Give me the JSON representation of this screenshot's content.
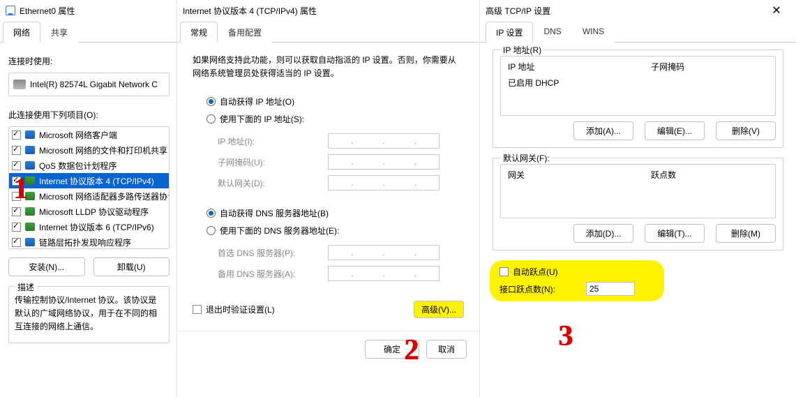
{
  "d1": {
    "title": "Ethernet0 属性",
    "tab_network": "网络",
    "tab_share": "共享",
    "connect_using": "连接时使用:",
    "adapter": "Intel(R) 82574L Gigabit Network C",
    "uses_items": "此连接使用下列项目(O):",
    "items": [
      {
        "checked": true,
        "label": "Microsoft 网络客户端",
        "sel": false
      },
      {
        "checked": true,
        "label": "Microsoft 网络的文件和打印机共享",
        "sel": false
      },
      {
        "checked": true,
        "label": "QoS 数据包计划程序",
        "sel": false
      },
      {
        "checked": true,
        "label": "Internet 协议版本 4 (TCP/IPv4)",
        "sel": true
      },
      {
        "checked": false,
        "label": "Microsoft 网络适配器多路传送器协议",
        "sel": false
      },
      {
        "checked": true,
        "label": "Microsoft LLDP 协议驱动程序",
        "sel": false
      },
      {
        "checked": true,
        "label": "Internet 协议版本 6 (TCP/IPv6)",
        "sel": false
      },
      {
        "checked": true,
        "label": "链路层拓扑发现响应程序",
        "sel": false
      }
    ],
    "install": "安装(N)...",
    "uninstall": "卸载(U)",
    "desc_legend": "描述",
    "desc_text": "传输控制协议/Internet 协议。该协议是默认的广域网络协议，用于在不同的相互连接的网络上通信。"
  },
  "d2": {
    "title": "Internet 协议版本 4 (TCP/IPv4) 属性",
    "tab_general": "常规",
    "tab_alt": "备用配置",
    "intro": "如果网络支持此功能，则可以获取自动指派的 IP 设置。否则，你需要从网络系统管理员处获得适当的 IP 设置。",
    "r_auto_ip": "自动获得 IP 地址(O)",
    "r_manual_ip": "使用下面的 IP 地址(S):",
    "f_ip": "IP 地址(I):",
    "f_mask": "子网掩码(U):",
    "f_gw": "默认网关(D):",
    "r_auto_dns": "自动获得 DNS 服务器地址(B)",
    "r_manual_dns": "使用下面的 DNS 服务器地址(E):",
    "f_dns1": "首选 DNS 服务器(P):",
    "f_dns2": "备用 DNS 服务器(A):",
    "chk_validate": "退出时验证设置(L)",
    "advanced": "高级(V)...",
    "ok": "确定",
    "cancel": "取消"
  },
  "d3": {
    "title": "高级 TCP/IP 设置",
    "tab_ip": "IP 设置",
    "tab_dns": "DNS",
    "tab_wins": "WINS",
    "grp_ip": "IP 地址(R)",
    "col_ip": "IP 地址",
    "col_mask": "子网掩码",
    "dhcp_row": "已启用 DHCP",
    "add": "添加(A)...",
    "edit": "编辑(E)...",
    "del": "删除(V)",
    "grp_gw": "默认网关(F):",
    "col_gw": "网关",
    "col_metric": "跃点数",
    "addD": "添加(D)...",
    "editT": "编辑(T)...",
    "delM": "删除(M)",
    "chk_auto_metric": "自动跃点(U)",
    "lbl_if_metric": "接口跃点数(N):",
    "metric_value": "25"
  }
}
